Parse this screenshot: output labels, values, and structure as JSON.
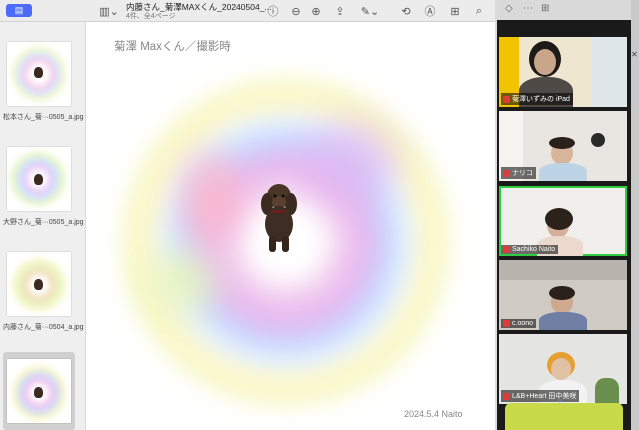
{
  "toolbar": {
    "title": "内藤さん_菊澤MAXくん_20240504_...",
    "subtitle": "4件、全4ページ",
    "icons": [
      "sidebar-icon",
      "view-icon",
      "info-icon",
      "zoom-out-icon",
      "zoom-in-icon",
      "share-icon",
      "markup-icon",
      "rotate-icon",
      "annotate-icon",
      "search-icon"
    ]
  },
  "thumbnails": [
    {
      "caption": "松本さん_菊···0505_a.jpg"
    },
    {
      "caption": "大野さん_菊···0505_a.jpg"
    },
    {
      "caption": "内藤さん_菊···0504_a.jpg"
    }
  ],
  "page": {
    "heading": "菊澤 Maxくん／撮影時",
    "footer": "2024.5.4 Naito"
  },
  "participants": [
    {
      "name": "菊澤いずみの iPad",
      "active": false
    },
    {
      "name": "ナリコ",
      "active": false
    },
    {
      "name": "Sachiko Naito",
      "active": true
    },
    {
      "name": "c.oono",
      "active": false
    },
    {
      "name": "L&B+Heart 田中美咲",
      "active": false
    }
  ],
  "colors": {
    "accent": "#4a6cf7",
    "active_speaker": "#2ecc40",
    "mute": "#e03a3a"
  }
}
